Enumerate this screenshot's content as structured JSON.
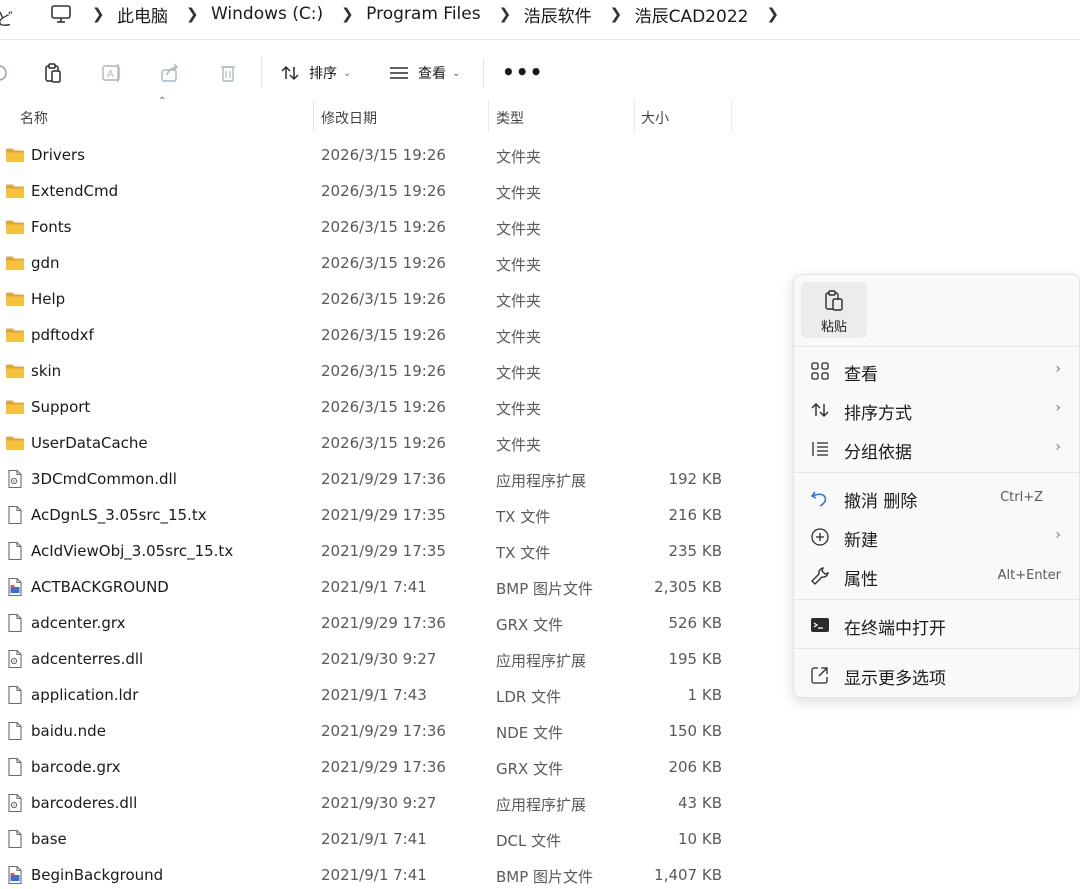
{
  "address": {
    "crumbs": [
      "此电脑",
      "Windows (C:)",
      "Program Files",
      "浩辰软件",
      "浩辰CAD2022"
    ],
    "left_edge_char": "ど"
  },
  "toolbar": {
    "sort_label": "排序",
    "view_label": "查看",
    "more_label": "•••"
  },
  "columns": {
    "name": "名称",
    "date": "修改日期",
    "type": "类型",
    "size": "大小"
  },
  "files": [
    {
      "name": "Drivers",
      "date": "2026/3/15 19:26",
      "type": "文件夹",
      "size": "",
      "icon": "folder-icon"
    },
    {
      "name": "ExtendCmd",
      "date": "2026/3/15 19:26",
      "type": "文件夹",
      "size": "",
      "icon": "folder-icon"
    },
    {
      "name": "Fonts",
      "date": "2026/3/15 19:26",
      "type": "文件夹",
      "size": "",
      "icon": "folder-icon"
    },
    {
      "name": "gdn",
      "date": "2026/3/15 19:26",
      "type": "文件夹",
      "size": "",
      "icon": "folder-icon"
    },
    {
      "name": "Help",
      "date": "2026/3/15 19:26",
      "type": "文件夹",
      "size": "",
      "icon": "folder-icon"
    },
    {
      "name": "pdftodxf",
      "date": "2026/3/15 19:26",
      "type": "文件夹",
      "size": "",
      "icon": "folder-icon"
    },
    {
      "name": "skin",
      "date": "2026/3/15 19:26",
      "type": "文件夹",
      "size": "",
      "icon": "folder-icon"
    },
    {
      "name": "Support",
      "date": "2026/3/15 19:26",
      "type": "文件夹",
      "size": "",
      "icon": "folder-icon"
    },
    {
      "name": "UserDataCache",
      "date": "2026/3/15 19:26",
      "type": "文件夹",
      "size": "",
      "icon": "folder-icon"
    },
    {
      "name": "3DCmdCommon.dll",
      "date": "2021/9/29 17:36",
      "type": "应用程序扩展",
      "size": "192 KB",
      "icon": "dll-file-icon"
    },
    {
      "name": "AcDgnLS_3.05src_15.tx",
      "date": "2021/9/29 17:35",
      "type": "TX 文件",
      "size": "216 KB",
      "icon": "file-icon"
    },
    {
      "name": "AcIdViewObj_3.05src_15.tx",
      "date": "2021/9/29 17:35",
      "type": "TX 文件",
      "size": "235 KB",
      "icon": "file-icon"
    },
    {
      "name": "ACTBACKGROUND",
      "date": "2021/9/1 7:41",
      "type": "BMP 图片文件",
      "size": "2,305 KB",
      "icon": "image-file-icon"
    },
    {
      "name": "adcenter.grx",
      "date": "2021/9/29 17:36",
      "type": "GRX 文件",
      "size": "526 KB",
      "icon": "file-icon"
    },
    {
      "name": "adcenterres.dll",
      "date": "2021/9/30 9:27",
      "type": "应用程序扩展",
      "size": "195 KB",
      "icon": "dll-file-icon"
    },
    {
      "name": "application.ldr",
      "date": "2021/9/1 7:43",
      "type": "LDR 文件",
      "size": "1 KB",
      "icon": "file-icon"
    },
    {
      "name": "baidu.nde",
      "date": "2021/9/29 17:36",
      "type": "NDE 文件",
      "size": "150 KB",
      "icon": "file-icon"
    },
    {
      "name": "barcode.grx",
      "date": "2021/9/29 17:36",
      "type": "GRX 文件",
      "size": "206 KB",
      "icon": "file-icon"
    },
    {
      "name": "barcoderes.dll",
      "date": "2021/9/30 9:27",
      "type": "应用程序扩展",
      "size": "43 KB",
      "icon": "dll-file-icon"
    },
    {
      "name": "base",
      "date": "2021/9/1 7:41",
      "type": "DCL 文件",
      "size": "10 KB",
      "icon": "file-icon"
    },
    {
      "name": "BeginBackground",
      "date": "2021/9/1 7:41",
      "type": "BMP 图片文件",
      "size": "1,407 KB",
      "icon": "image-file-icon"
    }
  ],
  "context_menu": {
    "paste_label": "粘贴",
    "items": [
      {
        "label": "查看",
        "shortcut": "",
        "submenu": true,
        "icon": "grid-view-icon"
      },
      {
        "label": "排序方式",
        "shortcut": "",
        "submenu": true,
        "icon": "sort-icon"
      },
      {
        "label": "分组依据",
        "shortcut": "",
        "submenu": true,
        "icon": "group-by-icon"
      },
      {
        "label": "撤消 删除",
        "shortcut": "Ctrl+Z",
        "submenu": false,
        "icon": "undo-icon"
      },
      {
        "label": "新建",
        "shortcut": "",
        "submenu": true,
        "icon": "new-plus-icon"
      },
      {
        "label": "属性",
        "shortcut": "Alt+Enter",
        "submenu": false,
        "icon": "wrench-icon"
      },
      {
        "label": "在终端中打开",
        "shortcut": "",
        "submenu": false,
        "icon": "terminal-icon"
      },
      {
        "label": "显示更多选项",
        "shortcut": "",
        "submenu": false,
        "icon": "external-link-icon"
      }
    ],
    "submenu_chevron": "›"
  },
  "colors": {
    "folder": "#f6c23e",
    "folder_dark": "#e4a727",
    "accent": "#2a6fdb",
    "menu_bg": "#f9f9f9"
  }
}
